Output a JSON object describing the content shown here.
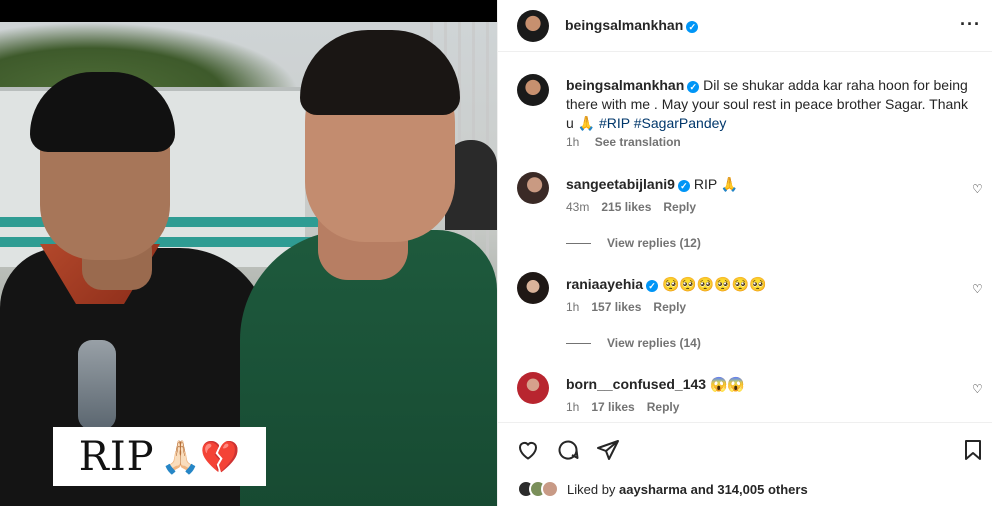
{
  "photo": {
    "overlay_text": "RIP",
    "overlay_emoji": "🙏🏻💔"
  },
  "header": {
    "username": "beingsalmankhan",
    "verified_mark": "✓",
    "more_glyph": "···"
  },
  "caption": {
    "username": "beingsalmankhan",
    "text": "Dil se shukar adda kar raha hoon for being there with me . May your soul rest in peace brother Sagar. Thank u 🙏",
    "hashtags": "#RIP #SagarPandey",
    "time": "1h",
    "see_translation": "See translation"
  },
  "comments": [
    {
      "username": "sangeetabijlani9",
      "verified": true,
      "text": "RIP 🙏",
      "time": "43m",
      "likes": "215 likes",
      "reply": "Reply",
      "view_replies": "View replies (12)"
    },
    {
      "username": "raniaayehia",
      "verified": true,
      "text": "🥺🥺🥺🥺🥺🥺",
      "time": "1h",
      "likes": "157 likes",
      "reply": "Reply",
      "view_replies": "View replies (14)"
    },
    {
      "username": "born__confused_143",
      "verified": false,
      "text": "😱😱",
      "time": "1h",
      "likes": "17 likes",
      "reply": "Reply"
    }
  ],
  "actions": {
    "like_icon": "heart-icon",
    "comment_icon": "comment-icon",
    "share_icon": "share-icon",
    "save_icon": "bookmark-icon"
  },
  "likes_summary": {
    "prefix": "Liked by",
    "user": "aaysharma",
    "suffix": "and 314,005 others"
  },
  "colors": {
    "verified": "#0095f6",
    "secondary_text": "#737373",
    "hashtag": "#00376b"
  }
}
